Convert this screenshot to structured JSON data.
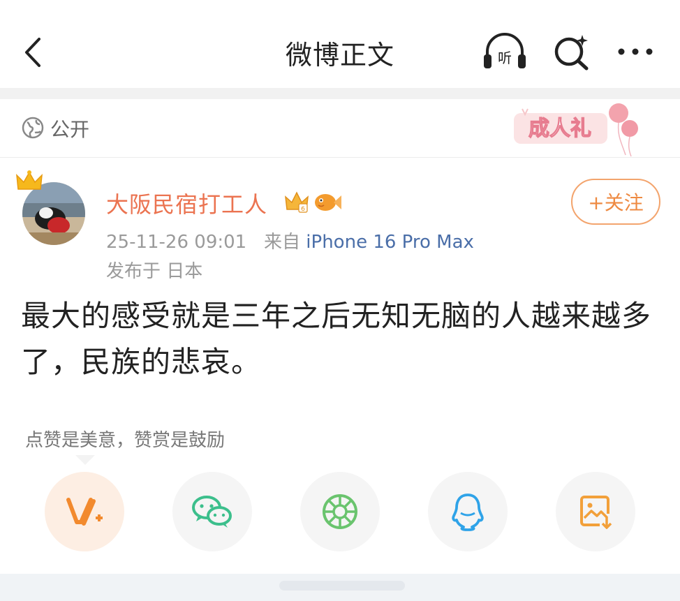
{
  "header": {
    "title": "微博正文",
    "listen_label": "听"
  },
  "visibility": {
    "label": "公开",
    "badge_text": "成人礼"
  },
  "author": {
    "name": "大阪民宿打工人",
    "follow_label": "+关注",
    "time": "25-11-26 09:01",
    "source_prefix": "来自",
    "device": "iPhone 16 Pro Max",
    "location": "发布于 日本"
  },
  "post": {
    "text": "最大的感受就是三年之后无知无脑的人越来越多了，民族的悲哀。"
  },
  "reward": {
    "hint": "点赞是美意，赞赏是鼓励"
  },
  "colors": {
    "accent_orange": "#eb7350",
    "link_blue": "#4a6ea8",
    "wechat_green": "#3cbf8c",
    "moments_green": "#6ac46e",
    "qq_blue": "#2fa3e8",
    "save_orange": "#f2a03a"
  },
  "icons": [
    "back-icon",
    "listen-icon",
    "search-icon",
    "more-icon",
    "globe-icon",
    "crown-icon",
    "vip-icon",
    "fish-icon",
    "reward-icon",
    "wechat-icon",
    "moments-icon",
    "qq-icon",
    "save-image-icon"
  ]
}
